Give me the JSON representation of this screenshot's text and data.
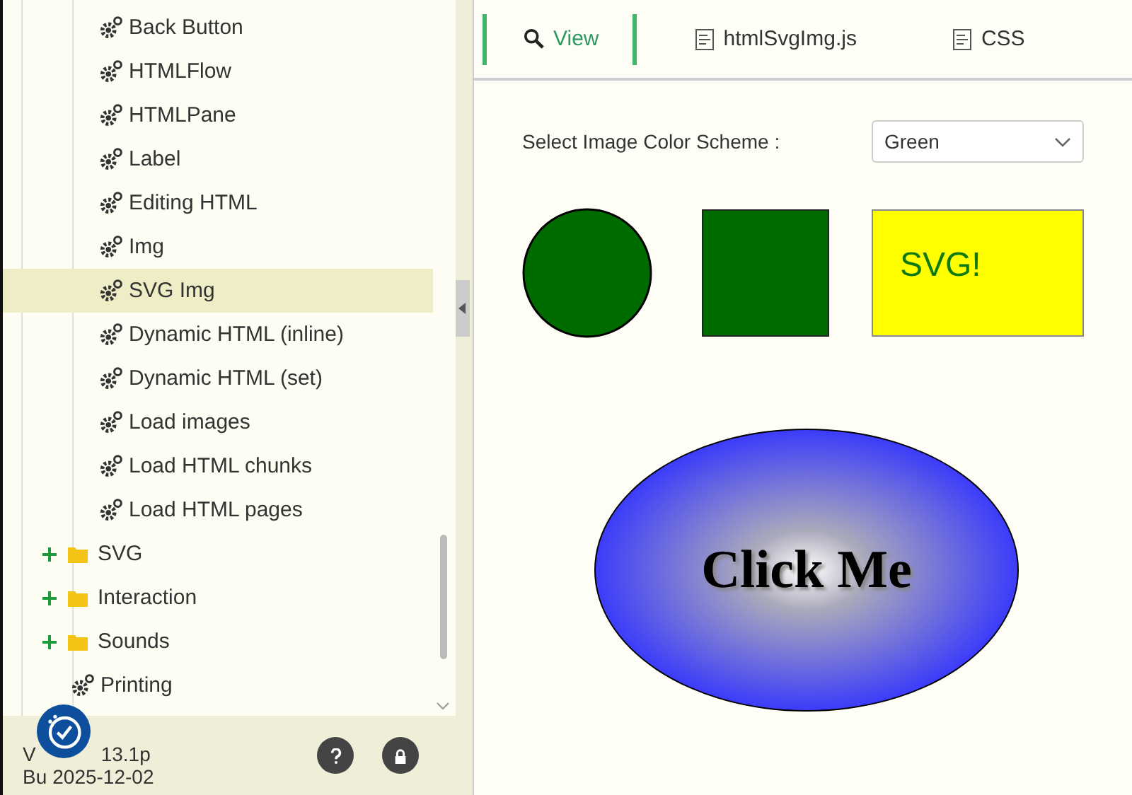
{
  "tree": [
    {
      "children": [
        {
          "label": "Back Button",
          "kind": "leaf",
          "selected": false
        },
        {
          "label": "HTMLFlow",
          "kind": "leaf",
          "selected": false
        },
        {
          "label": "HTMLPane",
          "kind": "leaf",
          "selected": false
        },
        {
          "label": "Label",
          "kind": "leaf",
          "selected": false
        },
        {
          "label": "Editing HTML",
          "kind": "leaf",
          "selected": false
        },
        {
          "label": "Img",
          "kind": "leaf",
          "selected": false
        },
        {
          "label": "SVG Img",
          "kind": "leaf",
          "selected": true
        },
        {
          "label": "Dynamic HTML (inline)",
          "kind": "leaf",
          "selected": false
        },
        {
          "label": "Dynamic HTML (set)",
          "kind": "leaf",
          "selected": false
        },
        {
          "label": "Load images",
          "kind": "leaf",
          "selected": false
        },
        {
          "label": "Load HTML chunks",
          "kind": "leaf",
          "selected": false
        },
        {
          "label": "Load HTML pages",
          "kind": "leaf",
          "selected": false
        }
      ]
    },
    {
      "label": "SVG",
      "kind": "folder",
      "selected": false,
      "expanded": false
    },
    {
      "label": "Interaction",
      "kind": "folder",
      "selected": false,
      "expanded": false
    },
    {
      "label": "Sounds",
      "kind": "folder",
      "selected": false,
      "expanded": false
    },
    {
      "label": "Printing",
      "kind": "leaf",
      "selected": false
    }
  ],
  "footer": {
    "version_prefix": "V",
    "version": "13.1p",
    "build_prefix": "Bu",
    "build": "2025-12-02"
  },
  "tabs": [
    {
      "label": "View",
      "kind": "view",
      "selected": true
    },
    {
      "label": "htmlSvgImg.js",
      "kind": "file",
      "selected": false
    },
    {
      "label": "CSS",
      "kind": "file",
      "selected": false
    }
  ],
  "color_scheme": {
    "label": "Select Image Color Scheme :",
    "value": "Green"
  },
  "svg_text": "SVG!",
  "click_text": "Click Me"
}
